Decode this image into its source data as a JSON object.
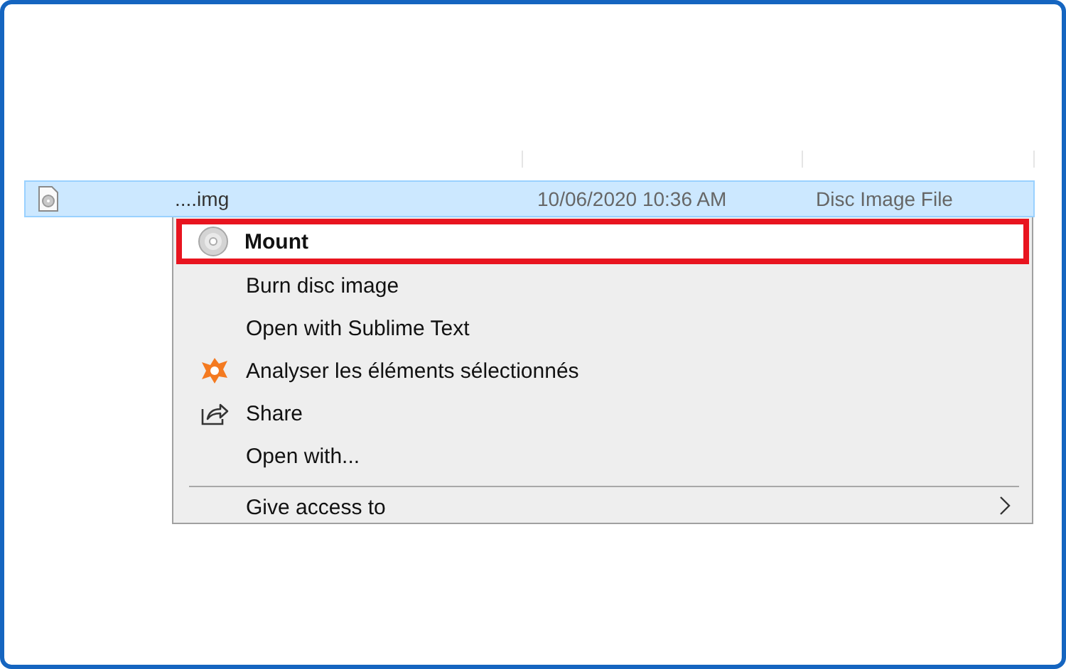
{
  "file_row": {
    "name": "....img",
    "date": "10/06/2020 10:36 AM",
    "type": "Disc Image File",
    "selected": true
  },
  "context_menu": {
    "items": [
      {
        "label": "Mount",
        "kind": "disc",
        "bold": true,
        "highlighted": true
      },
      {
        "label": "Burn disc image",
        "kind": "none",
        "bold": false,
        "highlighted": false
      },
      {
        "label": "Open with Sublime Text",
        "kind": "none",
        "bold": false,
        "highlighted": false
      },
      {
        "label": "Analyser les éléments sélectionnés",
        "kind": "avast",
        "bold": false,
        "highlighted": false
      },
      {
        "label": "Share",
        "kind": "share",
        "bold": false,
        "highlighted": false
      },
      {
        "label": "Open with...",
        "kind": "none",
        "bold": false,
        "highlighted": false
      },
      {
        "kind": "separator"
      },
      {
        "label": "Give access to",
        "kind": "none",
        "bold": false,
        "highlighted": false,
        "submenu": true
      }
    ]
  }
}
